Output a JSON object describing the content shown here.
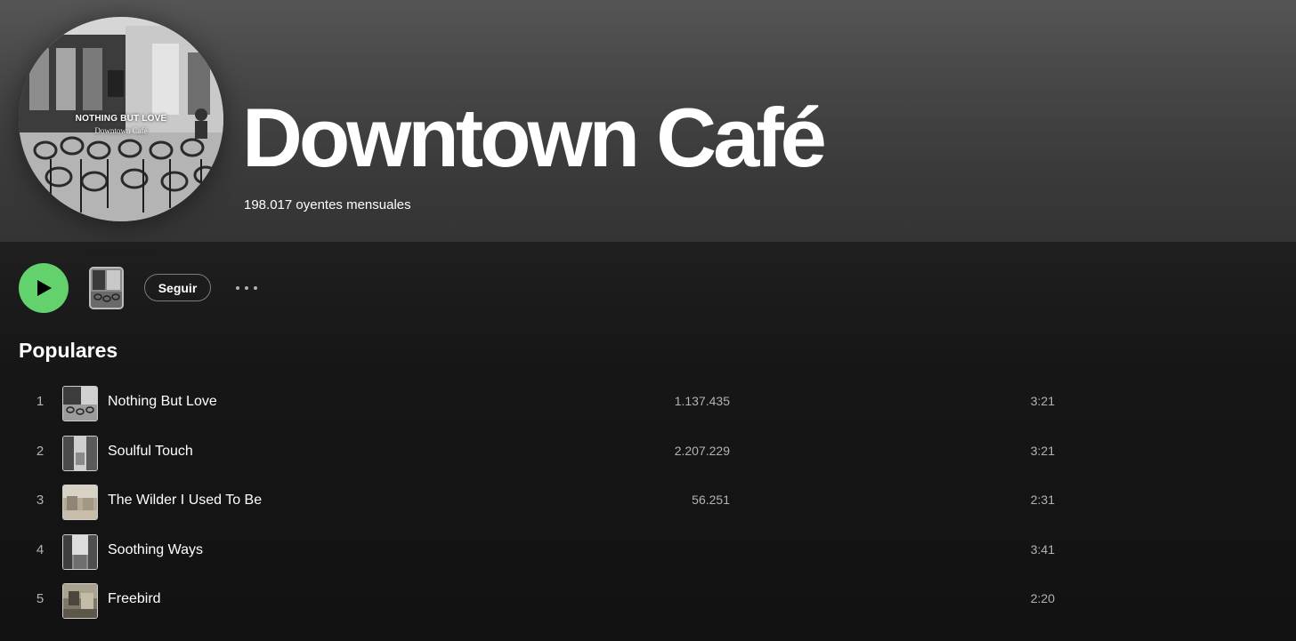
{
  "artist": {
    "name": "Downtown Café",
    "monthly_listeners": "198.017 oyentes mensuales",
    "avatar_text": {
      "title": "NOTHING BUT LOVE",
      "subtitle": "Downtown Café"
    }
  },
  "actions": {
    "play_icon": "play-icon",
    "follow_label": "Seguir",
    "more_icon": "more-options-icon"
  },
  "popular": {
    "heading": "Populares",
    "tracks": [
      {
        "number": "1",
        "title": "Nothing But Love",
        "plays": "1.137.435",
        "duration": "3:21"
      },
      {
        "number": "2",
        "title": "Soulful Touch",
        "plays": "2.207.229",
        "duration": "3:21"
      },
      {
        "number": "3",
        "title": "The Wilder I Used To Be",
        "plays": "56.251",
        "duration": "2:31"
      },
      {
        "number": "4",
        "title": "Soothing Ways",
        "plays": "",
        "duration": "3:41"
      },
      {
        "number": "5",
        "title": "Freebird",
        "plays": "",
        "duration": "2:20"
      }
    ]
  },
  "colors": {
    "play_button": "#63d16c",
    "background": "#121212",
    "header": "#4a4a4a",
    "muted_text": "#b3b3b3"
  }
}
